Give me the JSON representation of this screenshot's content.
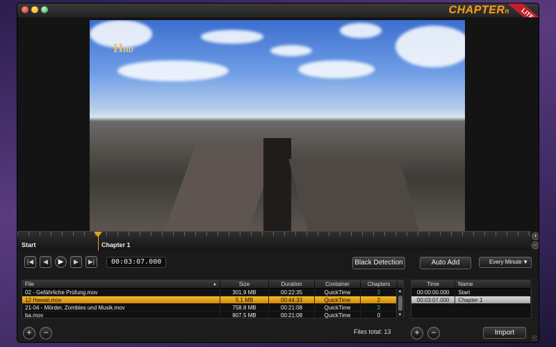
{
  "app": {
    "logo": "CHAPTER",
    "logo_suffix": "n",
    "edition": "LITE"
  },
  "video": {
    "channel_logo": "H",
    "channel_hd": "HD"
  },
  "timeline": {
    "markers": [
      "Start",
      "Chapter 1"
    ]
  },
  "transport": {
    "timecode": "00:03:07.000",
    "black_detection": "Black Detection",
    "auto_add": "Auto Add",
    "interval": "Every Minute"
  },
  "files": {
    "columns": [
      "File",
      "Size",
      "Duration",
      "Container",
      "Chapters"
    ],
    "rows": [
      {
        "file": "02 - Gefährliche Prüfung.mov",
        "size": "301.9 MB",
        "duration": "00:22:35",
        "container": "QuickTime",
        "chapters": "2"
      },
      {
        "file": "12 Hawaii.mov",
        "size": "5.1 MB",
        "duration": "00:44:33",
        "container": "QuickTime",
        "chapters": "2"
      },
      {
        "file": "21-04 - Mörder, Zombies und Musik.mov",
        "size": "758.8 MB",
        "duration": "00:21:08",
        "container": "QuickTime",
        "chapters": "2"
      },
      {
        "file": "ba.mov",
        "size": "807.5 MB",
        "duration": "00:21:08",
        "container": "QuickTime",
        "chapters": "0"
      }
    ],
    "total": "Files total: 13"
  },
  "chapters": {
    "columns": [
      "Time",
      "Name"
    ],
    "rows": [
      {
        "time": "00:00:00.000",
        "name": "Start"
      },
      {
        "time": "00:03:07.000",
        "name": "Chapter 1"
      }
    ]
  },
  "actions": {
    "add": "+",
    "remove": "−",
    "import": "Import"
  },
  "colors": {
    "accent": "#e8a020",
    "chapters_green": "#3cd03c"
  }
}
